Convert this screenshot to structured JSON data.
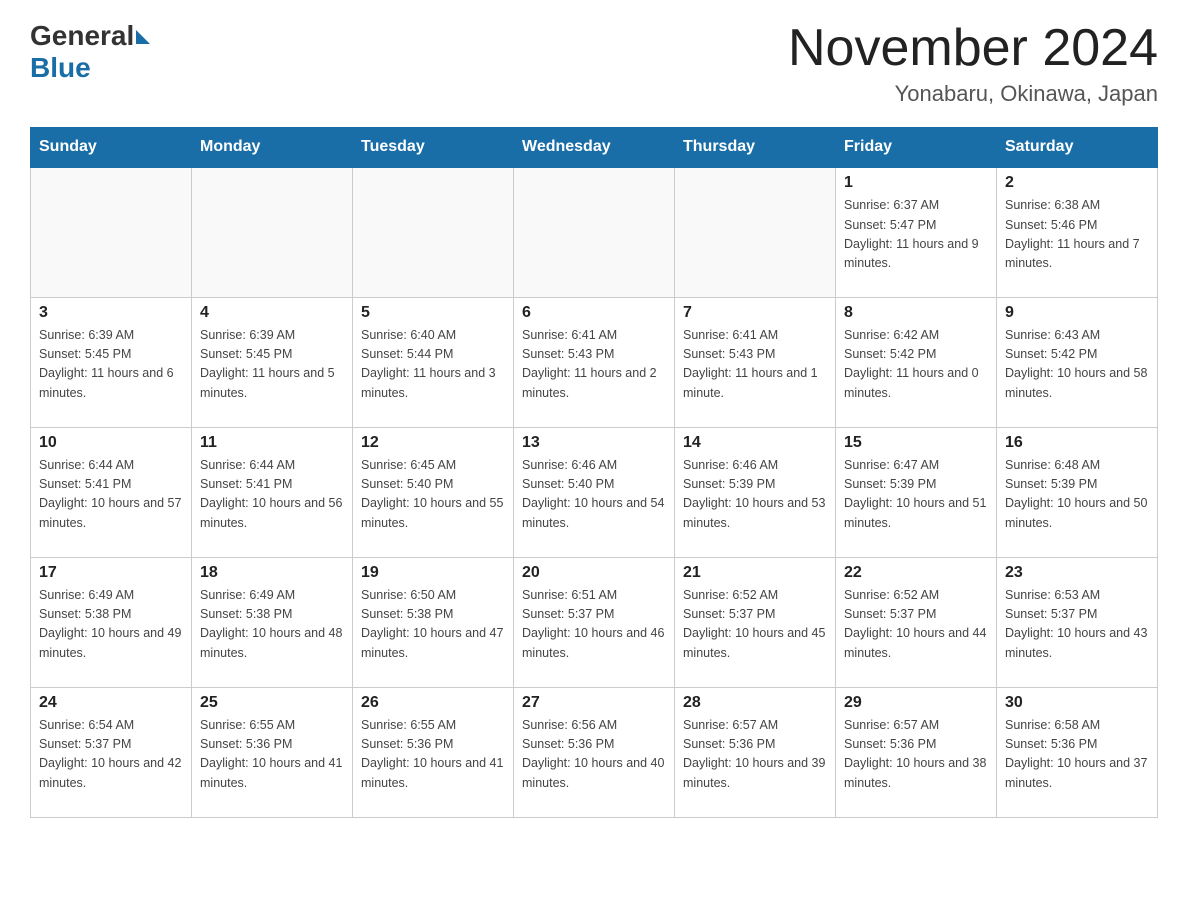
{
  "logo": {
    "general": "General",
    "blue": "Blue"
  },
  "calendar": {
    "title": "November 2024",
    "subtitle": "Yonabaru, Okinawa, Japan"
  },
  "days_of_week": [
    "Sunday",
    "Monday",
    "Tuesday",
    "Wednesday",
    "Thursday",
    "Friday",
    "Saturday"
  ],
  "weeks": [
    [
      {
        "day": "",
        "info": ""
      },
      {
        "day": "",
        "info": ""
      },
      {
        "day": "",
        "info": ""
      },
      {
        "day": "",
        "info": ""
      },
      {
        "day": "",
        "info": ""
      },
      {
        "day": "1",
        "info": "Sunrise: 6:37 AM\nSunset: 5:47 PM\nDaylight: 11 hours and 9 minutes."
      },
      {
        "day": "2",
        "info": "Sunrise: 6:38 AM\nSunset: 5:46 PM\nDaylight: 11 hours and 7 minutes."
      }
    ],
    [
      {
        "day": "3",
        "info": "Sunrise: 6:39 AM\nSunset: 5:45 PM\nDaylight: 11 hours and 6 minutes."
      },
      {
        "day": "4",
        "info": "Sunrise: 6:39 AM\nSunset: 5:45 PM\nDaylight: 11 hours and 5 minutes."
      },
      {
        "day": "5",
        "info": "Sunrise: 6:40 AM\nSunset: 5:44 PM\nDaylight: 11 hours and 3 minutes."
      },
      {
        "day": "6",
        "info": "Sunrise: 6:41 AM\nSunset: 5:43 PM\nDaylight: 11 hours and 2 minutes."
      },
      {
        "day": "7",
        "info": "Sunrise: 6:41 AM\nSunset: 5:43 PM\nDaylight: 11 hours and 1 minute."
      },
      {
        "day": "8",
        "info": "Sunrise: 6:42 AM\nSunset: 5:42 PM\nDaylight: 11 hours and 0 minutes."
      },
      {
        "day": "9",
        "info": "Sunrise: 6:43 AM\nSunset: 5:42 PM\nDaylight: 10 hours and 58 minutes."
      }
    ],
    [
      {
        "day": "10",
        "info": "Sunrise: 6:44 AM\nSunset: 5:41 PM\nDaylight: 10 hours and 57 minutes."
      },
      {
        "day": "11",
        "info": "Sunrise: 6:44 AM\nSunset: 5:41 PM\nDaylight: 10 hours and 56 minutes."
      },
      {
        "day": "12",
        "info": "Sunrise: 6:45 AM\nSunset: 5:40 PM\nDaylight: 10 hours and 55 minutes."
      },
      {
        "day": "13",
        "info": "Sunrise: 6:46 AM\nSunset: 5:40 PM\nDaylight: 10 hours and 54 minutes."
      },
      {
        "day": "14",
        "info": "Sunrise: 6:46 AM\nSunset: 5:39 PM\nDaylight: 10 hours and 53 minutes."
      },
      {
        "day": "15",
        "info": "Sunrise: 6:47 AM\nSunset: 5:39 PM\nDaylight: 10 hours and 51 minutes."
      },
      {
        "day": "16",
        "info": "Sunrise: 6:48 AM\nSunset: 5:39 PM\nDaylight: 10 hours and 50 minutes."
      }
    ],
    [
      {
        "day": "17",
        "info": "Sunrise: 6:49 AM\nSunset: 5:38 PM\nDaylight: 10 hours and 49 minutes."
      },
      {
        "day": "18",
        "info": "Sunrise: 6:49 AM\nSunset: 5:38 PM\nDaylight: 10 hours and 48 minutes."
      },
      {
        "day": "19",
        "info": "Sunrise: 6:50 AM\nSunset: 5:38 PM\nDaylight: 10 hours and 47 minutes."
      },
      {
        "day": "20",
        "info": "Sunrise: 6:51 AM\nSunset: 5:37 PM\nDaylight: 10 hours and 46 minutes."
      },
      {
        "day": "21",
        "info": "Sunrise: 6:52 AM\nSunset: 5:37 PM\nDaylight: 10 hours and 45 minutes."
      },
      {
        "day": "22",
        "info": "Sunrise: 6:52 AM\nSunset: 5:37 PM\nDaylight: 10 hours and 44 minutes."
      },
      {
        "day": "23",
        "info": "Sunrise: 6:53 AM\nSunset: 5:37 PM\nDaylight: 10 hours and 43 minutes."
      }
    ],
    [
      {
        "day": "24",
        "info": "Sunrise: 6:54 AM\nSunset: 5:37 PM\nDaylight: 10 hours and 42 minutes."
      },
      {
        "day": "25",
        "info": "Sunrise: 6:55 AM\nSunset: 5:36 PM\nDaylight: 10 hours and 41 minutes."
      },
      {
        "day": "26",
        "info": "Sunrise: 6:55 AM\nSunset: 5:36 PM\nDaylight: 10 hours and 41 minutes."
      },
      {
        "day": "27",
        "info": "Sunrise: 6:56 AM\nSunset: 5:36 PM\nDaylight: 10 hours and 40 minutes."
      },
      {
        "day": "28",
        "info": "Sunrise: 6:57 AM\nSunset: 5:36 PM\nDaylight: 10 hours and 39 minutes."
      },
      {
        "day": "29",
        "info": "Sunrise: 6:57 AM\nSunset: 5:36 PM\nDaylight: 10 hours and 38 minutes."
      },
      {
        "day": "30",
        "info": "Sunrise: 6:58 AM\nSunset: 5:36 PM\nDaylight: 10 hours and 37 minutes."
      }
    ]
  ]
}
